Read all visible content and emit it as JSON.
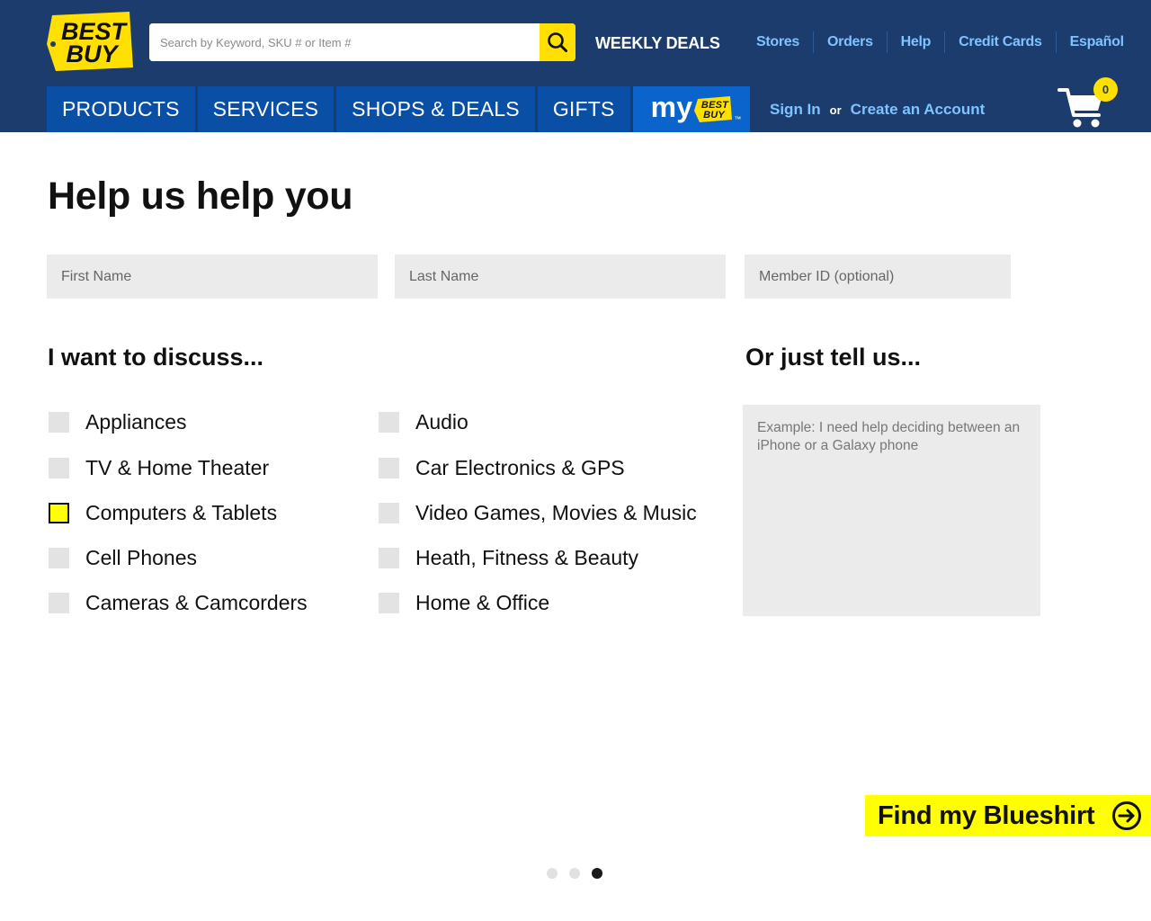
{
  "header": {
    "logo": {
      "line1": "BEST",
      "line2": "BUY"
    },
    "search": {
      "placeholder": "Search by Keyword, SKU # or Item #"
    },
    "weekly_deals": "WEEKLY DEALS",
    "top_links": [
      "Stores",
      "Orders",
      "Help",
      "Credit Cards",
      "Español"
    ],
    "nav_tabs": [
      "PRODUCTS",
      "SERVICES",
      "SHOPS & DEALS",
      "GIFTS"
    ],
    "my_tab": {
      "word": "my",
      "badge_line1": "BEST",
      "badge_line2": "BUY",
      "tm": "™"
    },
    "sign_in": "Sign In",
    "or_text": "or",
    "create_account": "Create an Account",
    "cart_count": "0"
  },
  "form": {
    "title": "Help us help you",
    "fields": {
      "first_name": "First Name",
      "last_name": "Last Name",
      "member_id": "Member ID (optional)"
    },
    "discuss_title": "I want to discuss...",
    "topics_left": [
      {
        "label": "Appliances",
        "checked": false
      },
      {
        "label": "TV & Home Theater",
        "checked": false
      },
      {
        "label": "Computers & Tablets",
        "checked": true
      },
      {
        "label": "Cell Phones",
        "checked": false
      },
      {
        "label": "Cameras & Camcorders",
        "checked": false
      }
    ],
    "topics_right": [
      {
        "label": "Audio",
        "checked": false
      },
      {
        "label": "Car Electronics & GPS",
        "checked": false
      },
      {
        "label": "Video Games, Movies & Music",
        "checked": false
      },
      {
        "label": "Heath, Fitness & Beauty",
        "checked": false
      },
      {
        "label": "Home & Office",
        "checked": false
      }
    ],
    "tell_title": "Or just tell us...",
    "tell_placeholder": "Example: I need help deciding between an iPhone or a Galaxy phone",
    "cta_label": "Find my Blueshirt"
  },
  "pagination": {
    "total": 3,
    "active_index": 2
  },
  "colors": {
    "header_bg": "#1d3c6e",
    "nav_tab": "#0a4fa6",
    "link_blue": "#7fc3ff",
    "brand_yellow": "#ffe000",
    "cta_yellow": "#ffff00"
  },
  "icons": {
    "search": "search-icon",
    "cart": "cart-icon",
    "cta": "arrow-right-circle-icon"
  }
}
